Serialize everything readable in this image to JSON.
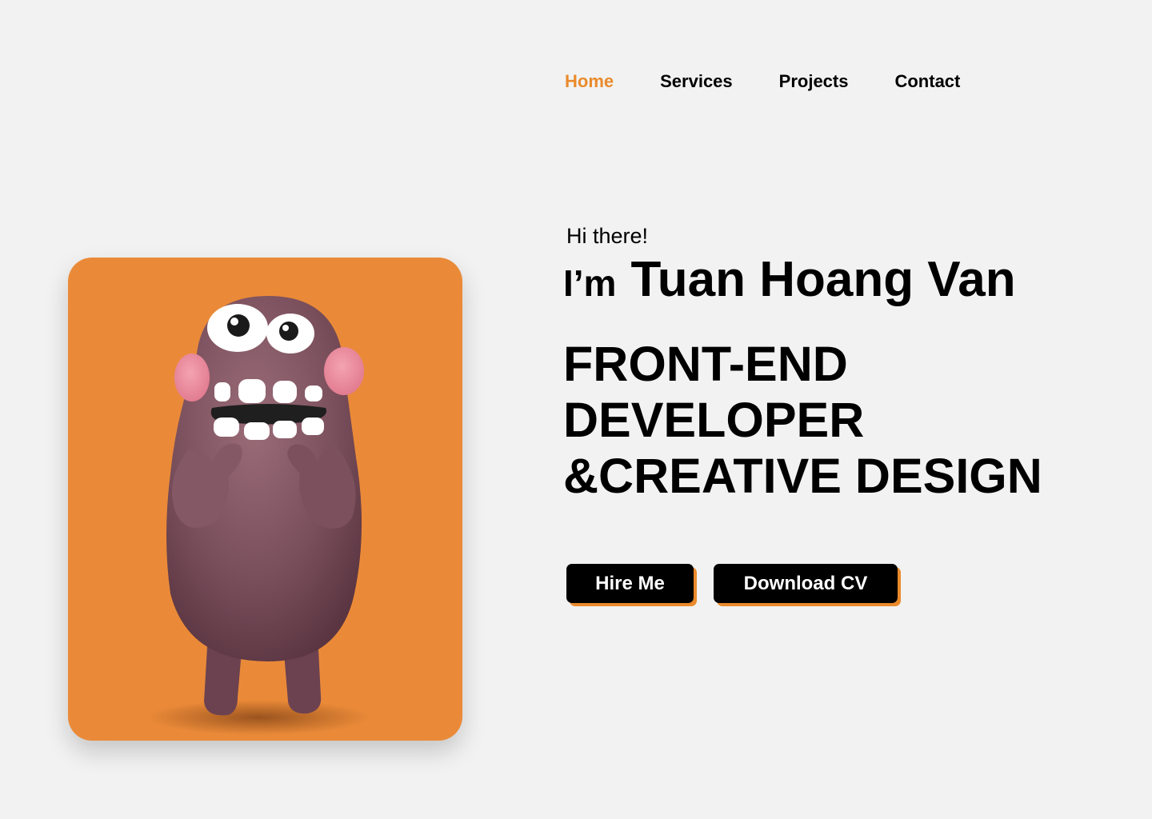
{
  "nav": {
    "items": [
      {
        "label": "Home",
        "active": true
      },
      {
        "label": "Services",
        "active": false
      },
      {
        "label": "Projects",
        "active": false
      },
      {
        "label": "Contact",
        "active": false
      }
    ]
  },
  "hero": {
    "greeting": "Hi there!",
    "intro_prefix": "I’m",
    "name": "Tuan Hoang Van",
    "role_lines": [
      "FRONT-END",
      "DEVELOPER",
      "&CREATIVE DESIGN"
    ],
    "hire_label": "Hire Me",
    "cv_label": "Download CV"
  },
  "illustration": {
    "subject": "monster-character-illustration"
  },
  "colors": {
    "accent": "#ea8a2c",
    "card_bg": "#ea8a38",
    "page_bg": "#f2f2f2",
    "button_bg": "#000000",
    "monster": "#7a4f5c"
  }
}
